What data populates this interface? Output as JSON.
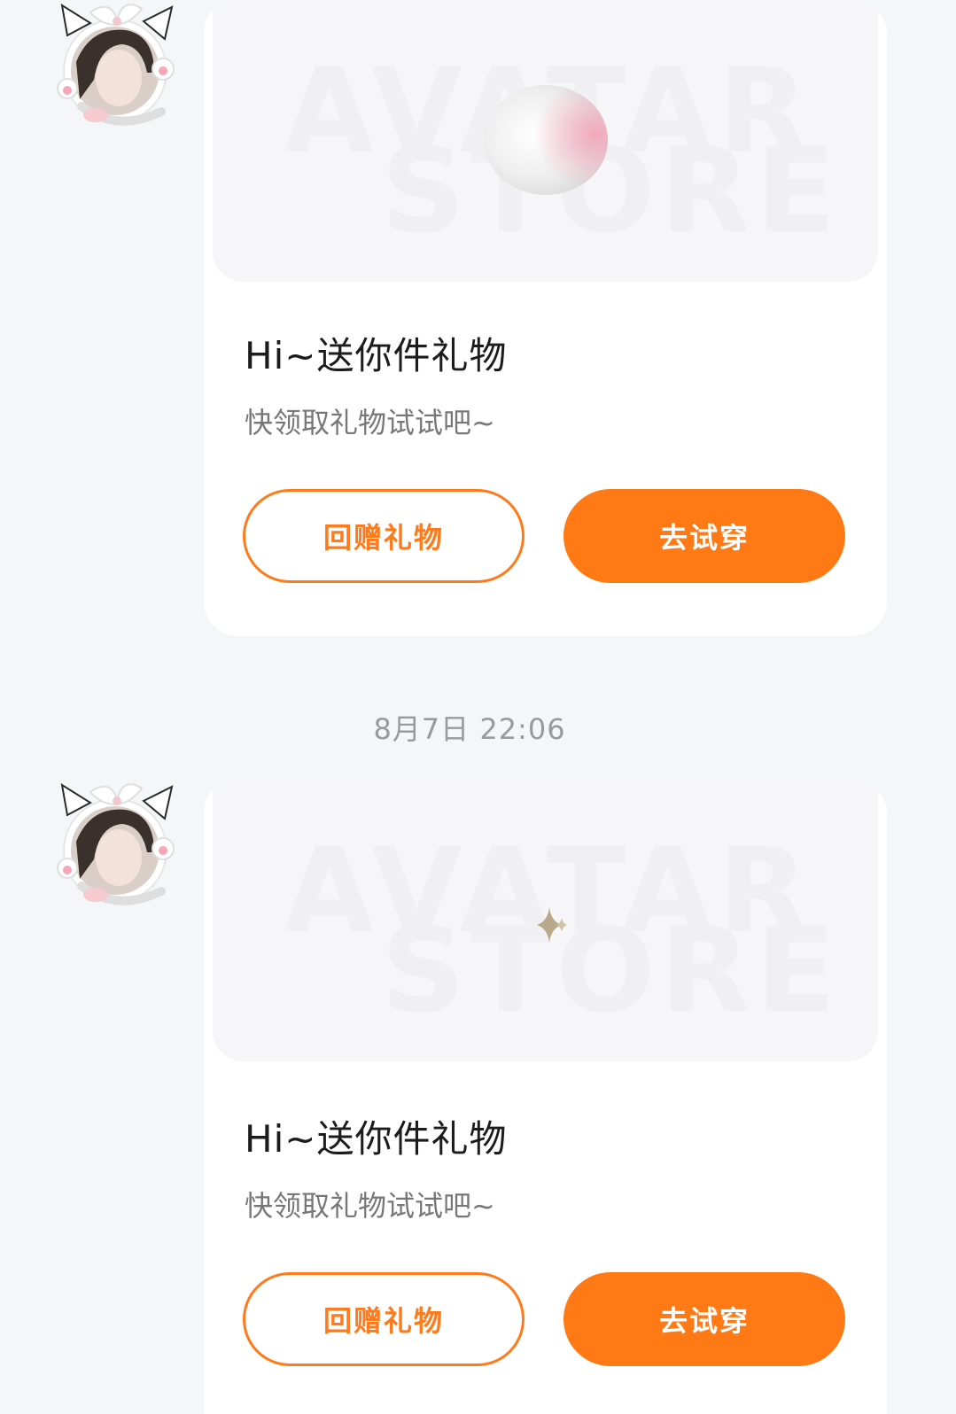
{
  "messages": [
    {
      "card": {
        "watermark_line1": "AVATAR",
        "watermark_line2": "STORE",
        "title": "Hi~送你件礼物",
        "subtitle": "快领取礼物试试吧~",
        "return_gift_label": "回赠礼物",
        "try_on_label": "去试穿"
      }
    },
    {
      "timestamp": "8月7日  22:06",
      "card": {
        "watermark_line1": "AVATAR",
        "watermark_line2": "STORE",
        "title": "Hi~送你件礼物",
        "subtitle": "快领取礼物试试吧~",
        "return_gift_label": "回赠礼物",
        "try_on_label": "去试穿"
      }
    }
  ],
  "colors": {
    "background": "#f5f6f8",
    "card": "#ffffff",
    "accent": "#ff7a14",
    "timestamp": "#9a9a9a",
    "title": "#1c1c1c",
    "subtitle": "#777777"
  },
  "icons": {
    "avatar": "cat-ear-avatar-icon",
    "gift_item_1": "peach-ball-icon",
    "gift_item_2": "sparkle-icon"
  }
}
